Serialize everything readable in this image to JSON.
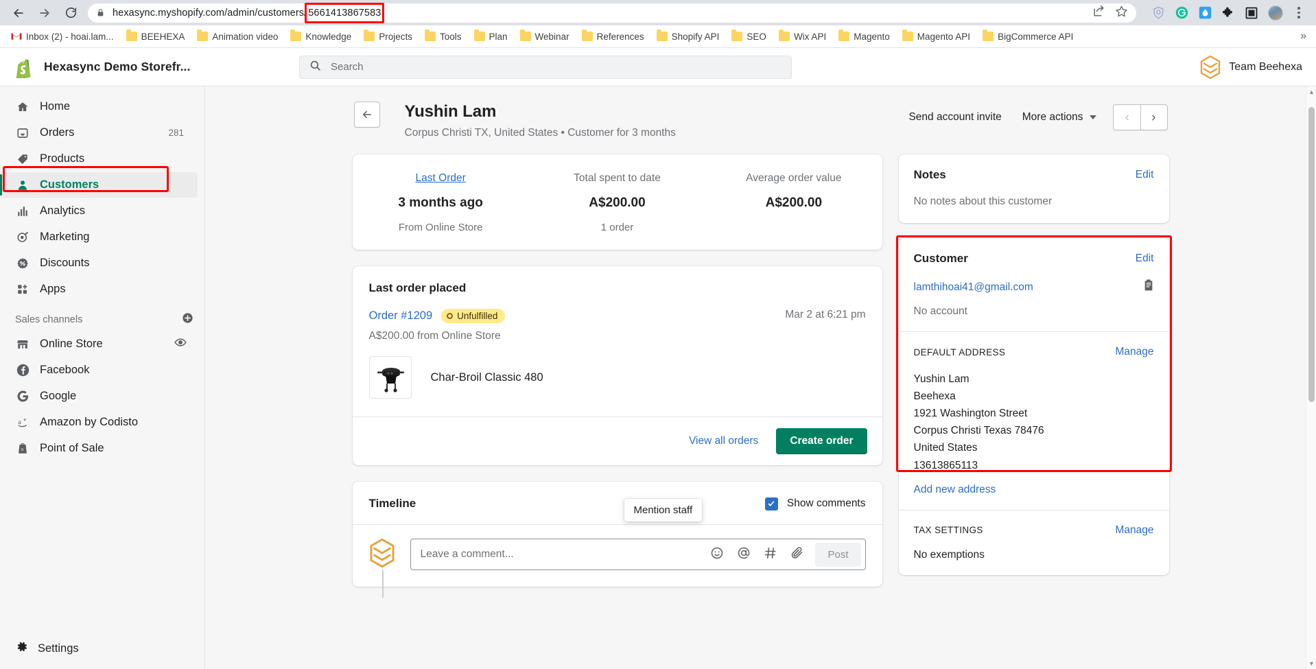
{
  "browser": {
    "url_prefix": "hexasync.myshopify.com/admin/customers/",
    "url_highlighted": "5661413867583",
    "nav": {
      "back": "back-arrow",
      "forward": "forward-arrow",
      "reload": "reload"
    },
    "bookmarks": [
      {
        "label": "Inbox (2) - hoai.lam...",
        "icon": "gmail-icon"
      },
      {
        "label": "BEEHEXA",
        "icon": "folder-icon"
      },
      {
        "label": "Animation video",
        "icon": "folder-icon"
      },
      {
        "label": "Knowledge",
        "icon": "folder-icon"
      },
      {
        "label": "Projects",
        "icon": "folder-icon"
      },
      {
        "label": "Tools",
        "icon": "folder-icon"
      },
      {
        "label": "Plan",
        "icon": "folder-icon"
      },
      {
        "label": "Webinar",
        "icon": "folder-icon"
      },
      {
        "label": "References",
        "icon": "folder-icon"
      },
      {
        "label": "Shopify API",
        "icon": "folder-icon"
      },
      {
        "label": "SEO",
        "icon": "folder-icon"
      },
      {
        "label": "Wix API",
        "icon": "folder-icon"
      },
      {
        "label": "Magento",
        "icon": "folder-icon"
      },
      {
        "label": "Magento API",
        "icon": "folder-icon"
      },
      {
        "label": "BigCommerce API",
        "icon": "folder-icon"
      }
    ],
    "bookmarks_overflow": "»",
    "extensions": [
      "shield-icon",
      "grammarly-icon",
      "water-drop-icon",
      "puzzle-piece-icon",
      "square-icon",
      "profile-avatar",
      "kebab-menu-icon"
    ]
  },
  "topbar": {
    "store_name": "Hexasync Demo Storefr...",
    "search_placeholder": "Search",
    "search_value": "",
    "account_name": "Team Beehexa"
  },
  "sidebar": {
    "items": [
      {
        "label": "Home",
        "icon": "home-icon",
        "badge": ""
      },
      {
        "label": "Orders",
        "icon": "orders-inbox-icon",
        "badge": "281"
      },
      {
        "label": "Products",
        "icon": "products-tag-icon",
        "badge": ""
      },
      {
        "label": "Customers",
        "icon": "customers-person-icon",
        "badge": "",
        "active": true
      },
      {
        "label": "Analytics",
        "icon": "analytics-bars-icon",
        "badge": ""
      },
      {
        "label": "Marketing",
        "icon": "marketing-target-icon",
        "badge": ""
      },
      {
        "label": "Discounts",
        "icon": "discounts-percent-icon",
        "badge": ""
      },
      {
        "label": "Apps",
        "icon": "apps-grid-icon",
        "badge": ""
      }
    ],
    "sales_channels_label": "Sales channels",
    "channels": [
      {
        "label": "Online Store",
        "icon": "storefront-icon",
        "trailing": "eye-icon"
      },
      {
        "label": "Facebook",
        "icon": "facebook-icon",
        "trailing": ""
      },
      {
        "label": "Google",
        "icon": "google-icon",
        "trailing": ""
      },
      {
        "label": "Amazon by Codisto",
        "icon": "amazon-icon",
        "trailing": ""
      },
      {
        "label": "Point of Sale",
        "icon": "point-of-sale-icon",
        "trailing": ""
      }
    ],
    "settings_label": "Settings"
  },
  "page": {
    "title": "Yushin Lam",
    "subtitle": "Corpus Christi TX, United States • Customer for 3 months",
    "send_invite_label": "Send account invite",
    "more_actions_label": "More actions"
  },
  "stats": [
    {
      "label": "Last Order",
      "is_link": true,
      "value": "3 months ago",
      "sub": "From Online Store"
    },
    {
      "label": "Total spent to date",
      "is_link": false,
      "value": "A$200.00",
      "sub": "1 order"
    },
    {
      "label": "Average order value",
      "is_link": false,
      "value": "A$200.00",
      "sub": ""
    }
  ],
  "last_order": {
    "heading": "Last order placed",
    "order_number": "Order #1209",
    "status": "Unfulfilled",
    "date": "Mar 2 at 6:21 pm",
    "amount_line": "A$200.00 from Online Store",
    "product_name": "Char-Broil Classic 480",
    "view_all_label": "View all orders",
    "create_order_label": "Create order"
  },
  "timeline": {
    "title": "Timeline",
    "show_comments_label": "Show comments",
    "comment_placeholder": "Leave a comment...",
    "post_label": "Post",
    "tooltip": "Mention staff",
    "icons": [
      "emoji-icon",
      "mention-at-icon",
      "hashtag-icon",
      "attachment-paperclip-icon"
    ]
  },
  "notes": {
    "title": "Notes",
    "edit_label": "Edit",
    "empty_text": "No notes about this customer"
  },
  "customer": {
    "title": "Customer",
    "edit_label": "Edit",
    "email": "lamthihoai41@gmail.com",
    "account_status": "No account",
    "address_label": "DEFAULT ADDRESS",
    "manage_label": "Manage",
    "address_lines": [
      "Yushin Lam",
      "Beehexa",
      "1921 Washington Street",
      "Corpus Christi Texas 78476",
      "United States",
      "13613865113"
    ],
    "add_address_label": "Add new address"
  },
  "tax": {
    "label": "TAX SETTINGS",
    "manage_label": "Manage",
    "value": "No exemptions"
  },
  "colors": {
    "accent_green": "#008060",
    "link_blue": "#2c6ecb",
    "annotation_red": "#ff0000",
    "pill_yellow": "#ffea8a"
  }
}
